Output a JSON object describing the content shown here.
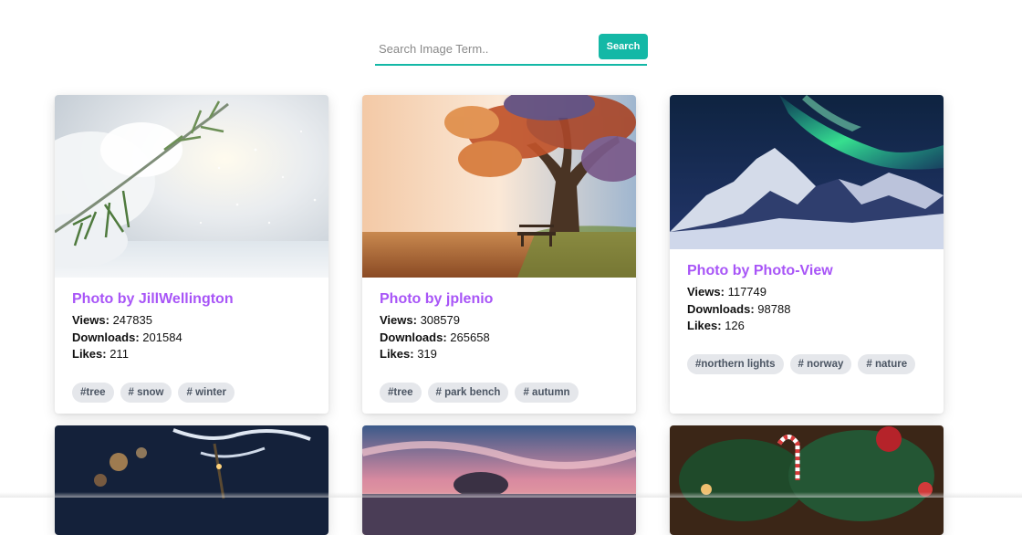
{
  "search": {
    "placeholder": "Search Image Term..",
    "button_label": "Search",
    "accent": "#14b8a6"
  },
  "colors": {
    "title": "#a855f7",
    "tag_bg": "#e5e7eb"
  },
  "labels": {
    "views": "Views:",
    "downloads": "Downloads:",
    "likes": "Likes:"
  },
  "cards": [
    {
      "title": "Photo by JillWellington",
      "views": "247835",
      "downloads": "201584",
      "likes": "211",
      "tags": [
        "#tree",
        "# snow",
        "# winter"
      ]
    },
    {
      "title": "Photo by jplenio",
      "views": "308579",
      "downloads": "265658",
      "likes": "319",
      "tags": [
        "#tree",
        "# park bench",
        "# autumn"
      ]
    },
    {
      "title": "Photo by Photo-View",
      "views": "117749",
      "downloads": "98788",
      "likes": "126",
      "tags": [
        "#northern lights",
        "# norway",
        "# nature"
      ]
    }
  ]
}
